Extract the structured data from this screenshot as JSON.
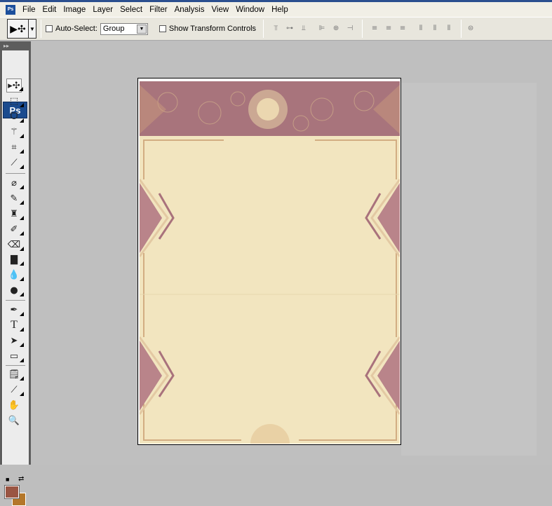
{
  "app": {
    "icon_label": "Ps"
  },
  "menu": [
    "File",
    "Edit",
    "Image",
    "Layer",
    "Select",
    "Filter",
    "Analysis",
    "View",
    "Window",
    "Help"
  ],
  "options_bar": {
    "auto_select_label": "Auto-Select:",
    "auto_select_checked": false,
    "auto_select_value": "Group",
    "show_transform_label": "Show Transform Controls",
    "show_transform_checked": false,
    "align_icons": [
      "align-top-icon",
      "align-vcenter-icon",
      "align-bottom-icon",
      "align-left-icon",
      "align-hcenter-icon",
      "align-right-icon"
    ],
    "distribute_icons": [
      "distribute-top-icon",
      "distribute-vcenter-icon",
      "distribute-bottom-icon",
      "distribute-left-icon",
      "distribute-hcenter-icon",
      "distribute-right-icon"
    ],
    "auto_align_icon": "auto-align-layers-icon"
  },
  "toolbox": {
    "logo": "Ps",
    "tools": [
      "move",
      "rectangular-marquee",
      "lasso",
      "magic-wand",
      "crop",
      "slice",
      "healing-brush",
      "brush",
      "clone-stamp",
      "history-brush",
      "eraser",
      "gradient",
      "blur",
      "dodge",
      "pen",
      "type",
      "path-selection",
      "rectangle",
      "notes",
      "eyedropper",
      "hand",
      "zoom"
    ],
    "foreground_color": "#9a5543",
    "background_color": "#b4772a"
  },
  "document": {
    "band_color": "#a8747c",
    "paper_color": "#f2e5bf"
  }
}
